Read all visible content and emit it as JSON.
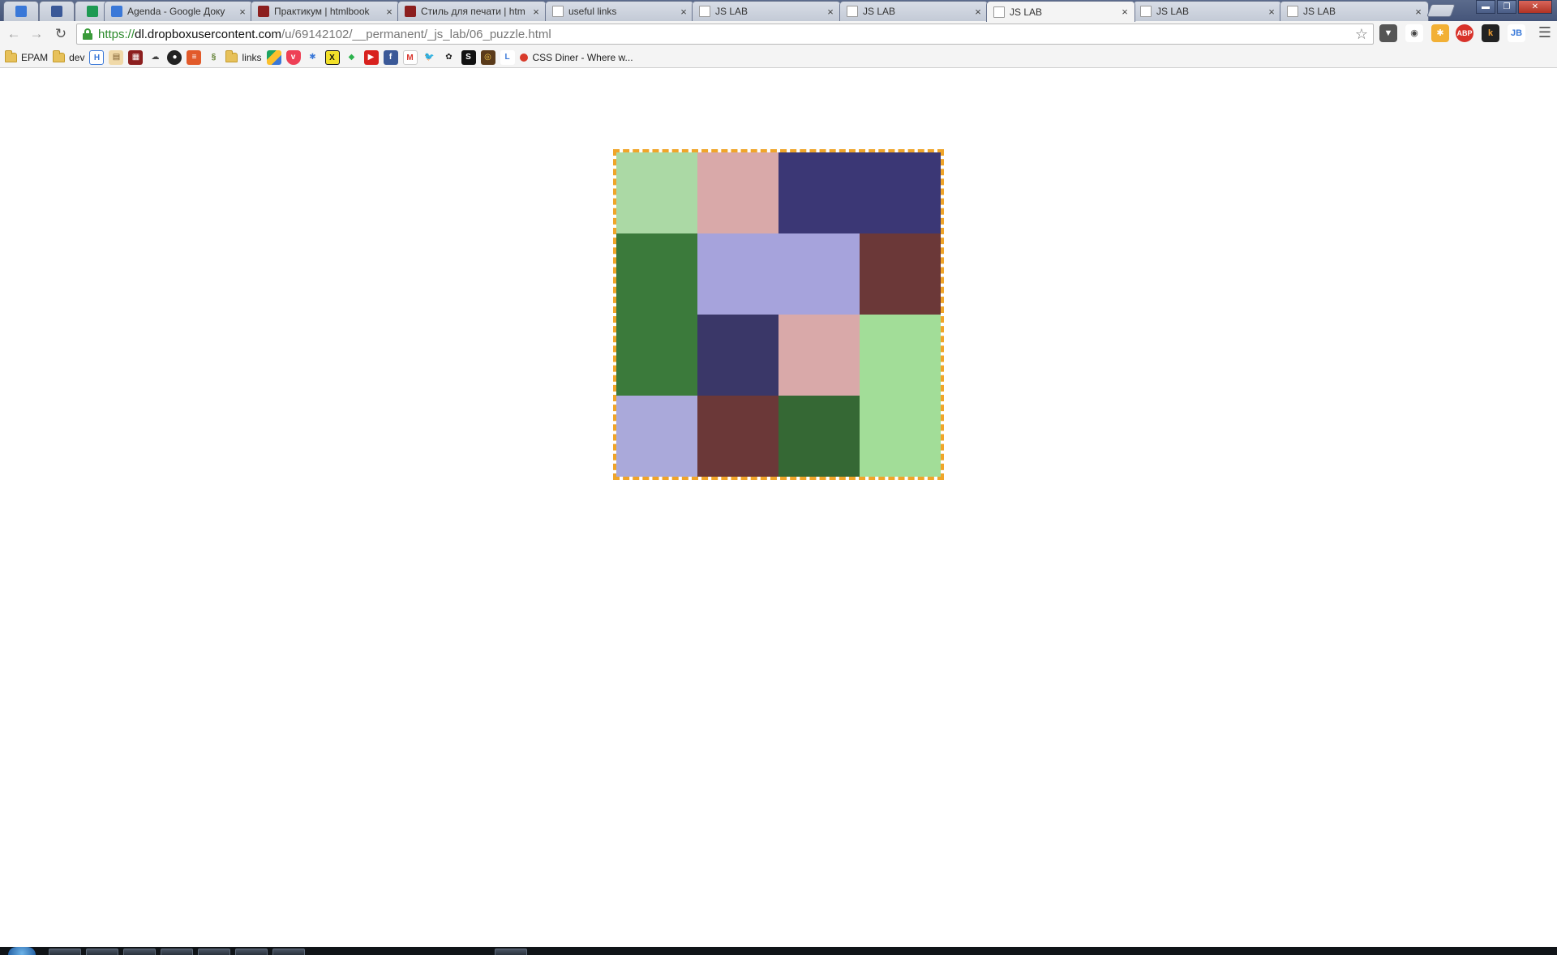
{
  "tabs": [
    {
      "title": "",
      "icon": "google-calendar-icon",
      "pinned": true
    },
    {
      "title": "",
      "icon": "facebook-icon",
      "pinned": true
    },
    {
      "title": "",
      "icon": "google-sheets-icon",
      "pinned": true
    },
    {
      "title": "Agenda - Google Доку",
      "icon": "google-docs-icon"
    },
    {
      "title": "Практикум | htmlbook",
      "icon": "htmlbook-icon"
    },
    {
      "title": "Стиль для печати | htm",
      "icon": "htmlbook-icon"
    },
    {
      "title": "useful links",
      "icon": "page-icon"
    },
    {
      "title": "JS LAB",
      "icon": "page-icon"
    },
    {
      "title": "JS LAB",
      "icon": "page-icon"
    },
    {
      "title": "JS LAB",
      "icon": "page-icon",
      "active": true
    },
    {
      "title": "JS LAB",
      "icon": "page-icon"
    },
    {
      "title": "JS LAB",
      "icon": "page-icon"
    }
  ],
  "window_buttons": {
    "minimize": "▬",
    "maximize": "❐",
    "close": "✕"
  },
  "omnibox": {
    "scheme": "https://",
    "host": "dl.dropboxusercontent.com",
    "path": "/u/69142102/__permanent/_js_lab/06_puzzle.html"
  },
  "bookmarks": [
    {
      "type": "folder",
      "label": "EPAM"
    },
    {
      "type": "folder",
      "label": "dev"
    },
    {
      "type": "icon",
      "icon": "h-icon"
    },
    {
      "type": "icon",
      "icon": "notepad-icon"
    },
    {
      "type": "icon",
      "icon": "htmlbook-icon"
    },
    {
      "type": "icon",
      "icon": "cloud-icon"
    },
    {
      "type": "icon",
      "icon": "github-icon"
    },
    {
      "type": "icon",
      "icon": "stackoverflow-icon"
    },
    {
      "type": "icon",
      "icon": "sass-icon"
    },
    {
      "type": "folder",
      "label": "links"
    },
    {
      "type": "icon",
      "icon": "google-drive-icon"
    },
    {
      "type": "icon",
      "icon": "pocket-icon"
    },
    {
      "type": "icon",
      "icon": "puzzle-icon"
    },
    {
      "type": "icon",
      "icon": "x-icon"
    },
    {
      "type": "icon",
      "icon": "feedly-icon"
    },
    {
      "type": "icon",
      "icon": "youtube-icon"
    },
    {
      "type": "icon",
      "icon": "facebook-icon"
    },
    {
      "type": "icon",
      "icon": "gmail-icon"
    },
    {
      "type": "icon",
      "icon": "twitter-icon"
    },
    {
      "type": "icon",
      "icon": "paw-icon"
    },
    {
      "type": "icon",
      "icon": "s-icon"
    },
    {
      "type": "icon",
      "icon": "flickr-icon"
    },
    {
      "type": "icon",
      "icon": "l-icon"
    },
    {
      "type": "link",
      "label": "CSS Diner - Where w..."
    }
  ],
  "puzzle": {
    "border_color": "#f0a52a",
    "cells": [
      {
        "row": 0,
        "col": 0,
        "color": "#abd9a5"
      },
      {
        "row": 0,
        "col": 1,
        "color": "#d9a9a9"
      },
      {
        "row": 0,
        "col": 2,
        "color": "#3b3775"
      },
      {
        "row": 0,
        "col": 3,
        "color": "#3b3775"
      },
      {
        "row": 1,
        "col": 0,
        "color": "#3b7a3b"
      },
      {
        "row": 1,
        "col": 1,
        "color": "#a6a3dc"
      },
      {
        "row": 1,
        "col": 2,
        "color": "#a6a3dc"
      },
      {
        "row": 1,
        "col": 3,
        "color": "#6b3838"
      },
      {
        "row": 2,
        "col": 0,
        "color": "#3b7a3b"
      },
      {
        "row": 2,
        "col": 1,
        "color": "#3a3768"
      },
      {
        "row": 2,
        "col": 2,
        "color": "#d9a9a9"
      },
      {
        "row": 2,
        "col": 3,
        "color": "#a2dd98"
      },
      {
        "row": 3,
        "col": 0,
        "color": "#aaa9da"
      },
      {
        "row": 3,
        "col": 1,
        "color": "#6b3838"
      },
      {
        "row": 3,
        "col": 2,
        "color": "#356834"
      },
      {
        "row": 3,
        "col": 3,
        "color": "#a2dd98"
      }
    ]
  }
}
